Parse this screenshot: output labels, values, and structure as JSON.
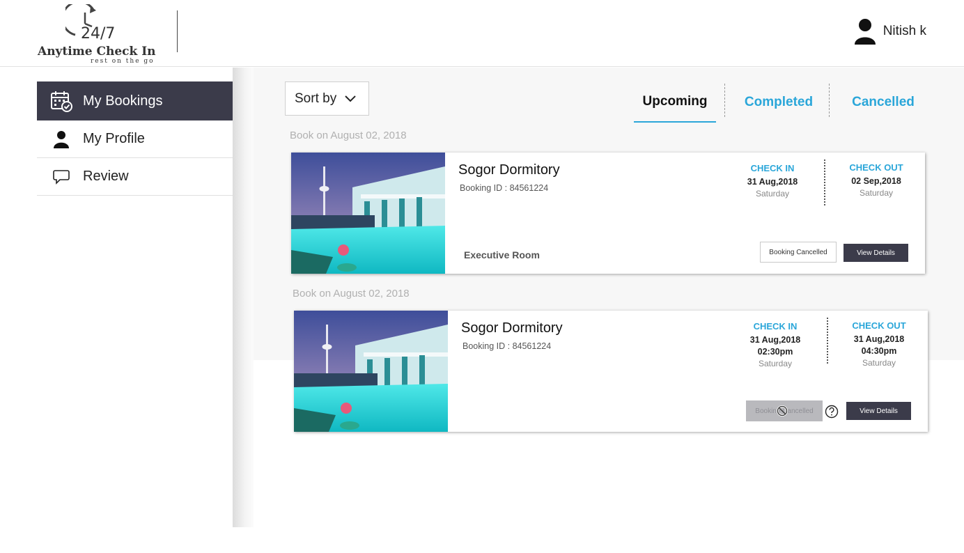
{
  "header": {
    "logo": {
      "number": "24/7",
      "title": "Anytime Check In",
      "tagline": "rest on the go"
    },
    "user": {
      "name": "Nitish k"
    }
  },
  "sidebar": {
    "items": [
      {
        "label": "My Bookings",
        "icon": "calendar-check-icon",
        "active": true
      },
      {
        "label": "My Profile",
        "icon": "person-icon",
        "active": false
      },
      {
        "label": "Review",
        "icon": "speech-bubble-icon",
        "active": false
      }
    ]
  },
  "toolbar": {
    "sort_label": "Sort by",
    "tabs": [
      {
        "label": "Upcoming",
        "active": true
      },
      {
        "label": "Completed",
        "active": false
      },
      {
        "label": "Cancelled",
        "active": false
      }
    ]
  },
  "bookings": [
    {
      "book_date": "Book on August 02, 2018",
      "hotel": "Sogor Dormitory",
      "booking_id": "Booking ID : 84561224",
      "room_type": "Executive Room",
      "check_in": {
        "label": "CHECK IN",
        "date": "31 Aug,2018",
        "day": "Saturday"
      },
      "check_out": {
        "label": "CHECK OUT",
        "date": "02 Sep,2018",
        "day": "Saturday"
      },
      "status_button": "Booking Cancelled",
      "details_button": "View Details"
    },
    {
      "book_date": "Book on August 02, 2018",
      "hotel": "Sogor Dormitory",
      "booking_id": "Booking ID : 84561224",
      "check_in": {
        "label": "CHECK IN",
        "date": "31 Aug,2018",
        "time": "02:30pm",
        "day": "Saturday"
      },
      "check_out": {
        "label": "CHECK OUT",
        "date": "31 Aug,2018",
        "time": "04:30pm",
        "day": "Saturday"
      },
      "status_button": "Booking Cancelled",
      "details_button": "View Details"
    }
  ],
  "colors": {
    "accent": "#2aa6d9",
    "dark": "#3b3b4a",
    "muted": "#b0b0b0"
  }
}
